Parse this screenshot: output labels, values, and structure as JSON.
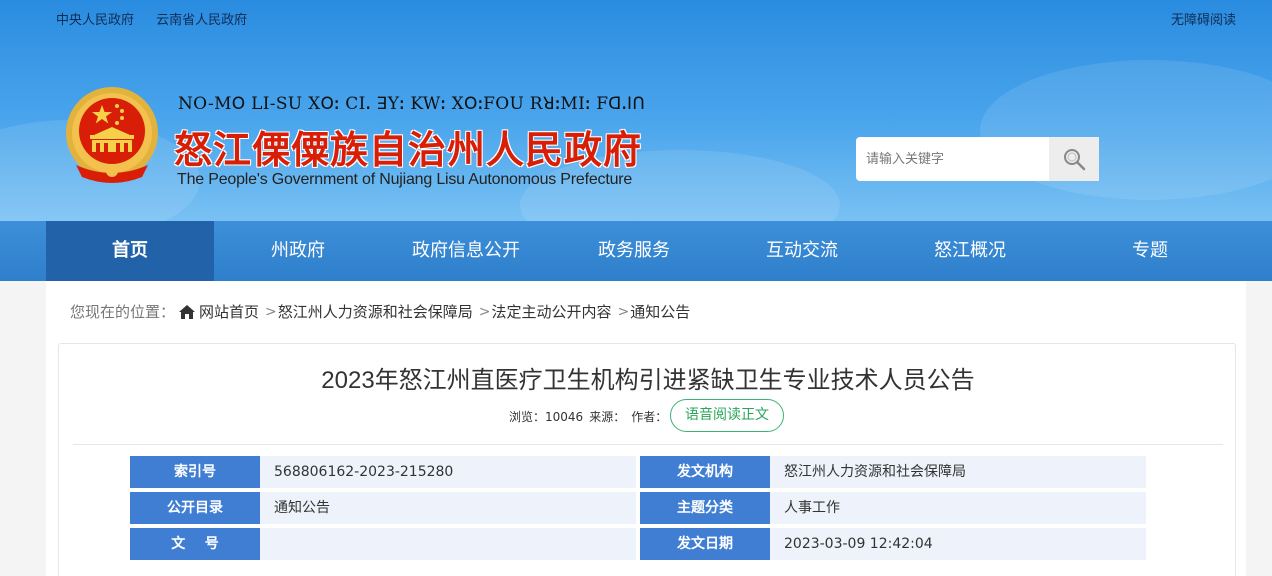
{
  "top_links": [
    "中央人民政府",
    "云南省人民政府"
  ],
  "accessibility_link": "无障碍阅读",
  "site": {
    "lisu_name": "NO-Mꓳ LI-SU Xꓳꓽ CIꓸ ꓱYꓽ KWꓽ XꓳꓽFOU RꓤꓽMIꓽ Fꓷꓸꓲꓵ",
    "name": "怒江傈僳族自治州人民政府",
    "english_name": "The People's Government of Nujiang Lisu Autonomous Prefecture",
    "emblem_icon": "national-emblem-icon"
  },
  "search": {
    "placeholder": "请输入关键字",
    "icon": "magnifier-icon"
  },
  "nav": [
    "首页",
    "州政府",
    "政府信息公开",
    "政务服务",
    "互动交流",
    "怒江概况",
    "专题"
  ],
  "nav_active_index": 0,
  "breadcrumb": {
    "lead": "您现在的位置：",
    "home_icon": "home-icon",
    "items": [
      "网站首页",
      "怒江州人力资源和社会保障局",
      "法定主动公开内容",
      "通知公告"
    ],
    "separator": ">"
  },
  "article": {
    "title": "2023年怒江州直医疗卫生机构引进紧缺卫生专业技术人员公告",
    "views_label": "浏览：",
    "views": "10046",
    "source_label": "来源：",
    "author_label": "作者：",
    "voice_button": "语音阅读正文"
  },
  "info_table": {
    "index_label": "索引号",
    "index_value": "568806162-2023-215280",
    "issuer_label": "发文机构",
    "issuer_value": "怒江州人力资源和社会保障局",
    "catalog_label": "公开目录",
    "catalog_value": "通知公告",
    "topic_label": "主题分类",
    "topic_value": "人事工作",
    "docno_label": "文    号",
    "docno_value": "",
    "date_label": "发文日期",
    "date_value": "2023-03-09 12:42:04"
  },
  "colors": {
    "nav_active": "#2162a8",
    "site_name": "#d81e06",
    "label_bg": "#3f7ed3",
    "voice_green": "#27a55a"
  }
}
